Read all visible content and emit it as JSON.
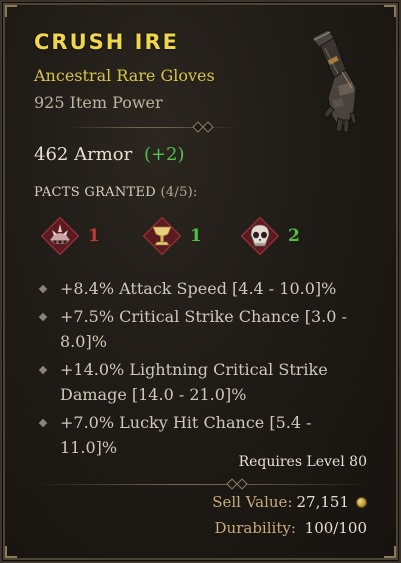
{
  "item": {
    "name": "CRUSH IRE",
    "type": "Ancestral Rare Gloves",
    "power": "925 Item Power",
    "icon": "gauntlet-glove-icon",
    "armor_value": "462 Armor",
    "armor_bonus": "(+2)"
  },
  "pacts": {
    "header": "PACTS GRANTED",
    "count": "(4/5):",
    "list": [
      {
        "icon": "spiked-shell-icon",
        "value": "1",
        "color": "#c23a2f"
      },
      {
        "icon": "chalice-icon",
        "value": "1",
        "color": "#4fbf45"
      },
      {
        "icon": "skull-icon",
        "value": "2",
        "color": "#4fbf45"
      }
    ]
  },
  "affixes": [
    "+8.4% Attack Speed [4.4 - 10.0]%",
    "+7.5% Critical Strike Chance [3.0 - 8.0]%",
    "+14.0% Lightning Critical Strike Damage [14.0 - 21.0]%",
    "+7.0% Lucky Hit Chance [5.4 - 11.0]%"
  ],
  "requirements": {
    "level": "Requires Level 80"
  },
  "footer": {
    "sell_label": "Sell Value:",
    "sell_value": "27,151",
    "gold_icon": "gold-coin-icon",
    "durability_label": "Durability:",
    "durability_value": "100/100"
  },
  "colors": {
    "name": "#f0d64a",
    "rare": "#d9c44a",
    "bonus": "#52c24c",
    "pact_red": "#c23a2f",
    "pact_green": "#4fbf45"
  }
}
